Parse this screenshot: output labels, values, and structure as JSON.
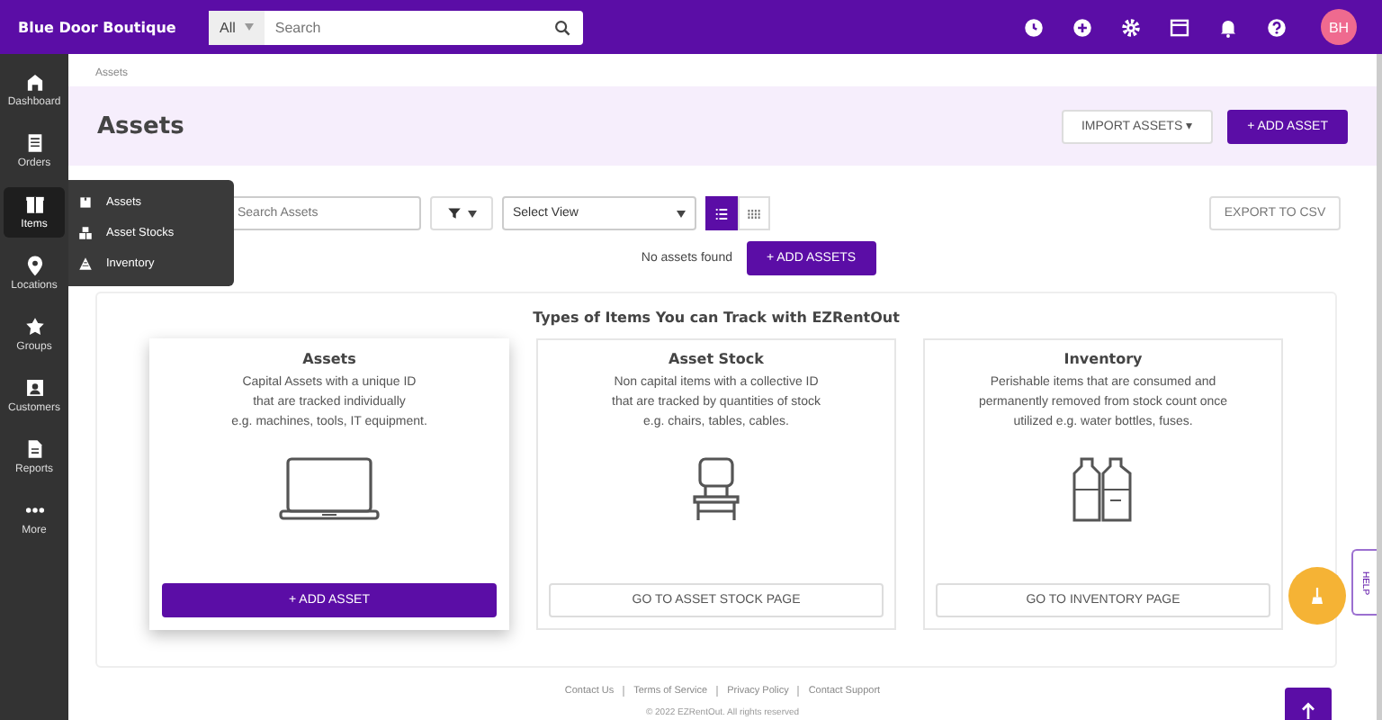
{
  "topbar": {
    "brand": "Blue Door Boutique",
    "search_scope": "All",
    "search_placeholder": "Search",
    "avatar": "BH"
  },
  "sidebar": {
    "items": [
      {
        "label": "Dashboard",
        "selected": false
      },
      {
        "label": "Orders",
        "selected": false
      },
      {
        "label": "Items",
        "selected": true
      },
      {
        "label": "Locations",
        "selected": false
      },
      {
        "label": "Groups",
        "selected": false
      },
      {
        "label": "Customers",
        "selected": false
      },
      {
        "label": "Reports",
        "selected": false
      },
      {
        "label": "More",
        "selected": false
      }
    ]
  },
  "flyout": {
    "items": [
      {
        "label": "Assets"
      },
      {
        "label": "Asset Stocks"
      },
      {
        "label": "Inventory"
      }
    ]
  },
  "breadcrumb": "Assets",
  "header": {
    "title": "Assets",
    "import_button": "IMPORT ASSETS ▾",
    "add_button": "+ ADD ASSET"
  },
  "toolbar": {
    "search_placeholder": "Search Assets",
    "view_placeholder": "Select View",
    "views": [
      {
        "selected": true
      },
      {
        "selected": false
      }
    ],
    "export_button": "EXPORT TO CSV"
  },
  "empty": {
    "message": "No assets found",
    "button": "+ ADD ASSETS"
  },
  "types": {
    "title": "Types of Items You can Track with EZRentOut",
    "cards": [
      {
        "title": "Assets",
        "lines": [
          "Capital Assets with a unique ID",
          "that are tracked individually",
          "e.g. machines, tools, IT equipment."
        ],
        "button": "+ ADD ASSET",
        "selected": true
      },
      {
        "title": "Asset Stock",
        "lines": [
          "Non capital items with a collective ID",
          "that are tracked by quantities of stock",
          "e.g. chairs, tables, cables."
        ],
        "button": "GO TO ASSET STOCK PAGE",
        "selected": false
      },
      {
        "title": "Inventory",
        "lines": [
          "Perishable items that are consumed and",
          "permanently removed from stock count once",
          "utilized e.g. water bottles, fuses."
        ],
        "button": "GO TO INVENTORY PAGE",
        "selected": false
      }
    ]
  },
  "footer": {
    "links": [
      "Contact Us",
      "Terms of Service",
      "Privacy Policy",
      "Contact Support"
    ],
    "copyright": "© 2022 EZRentOut. All rights reserved"
  },
  "help_tab": "HELP"
}
